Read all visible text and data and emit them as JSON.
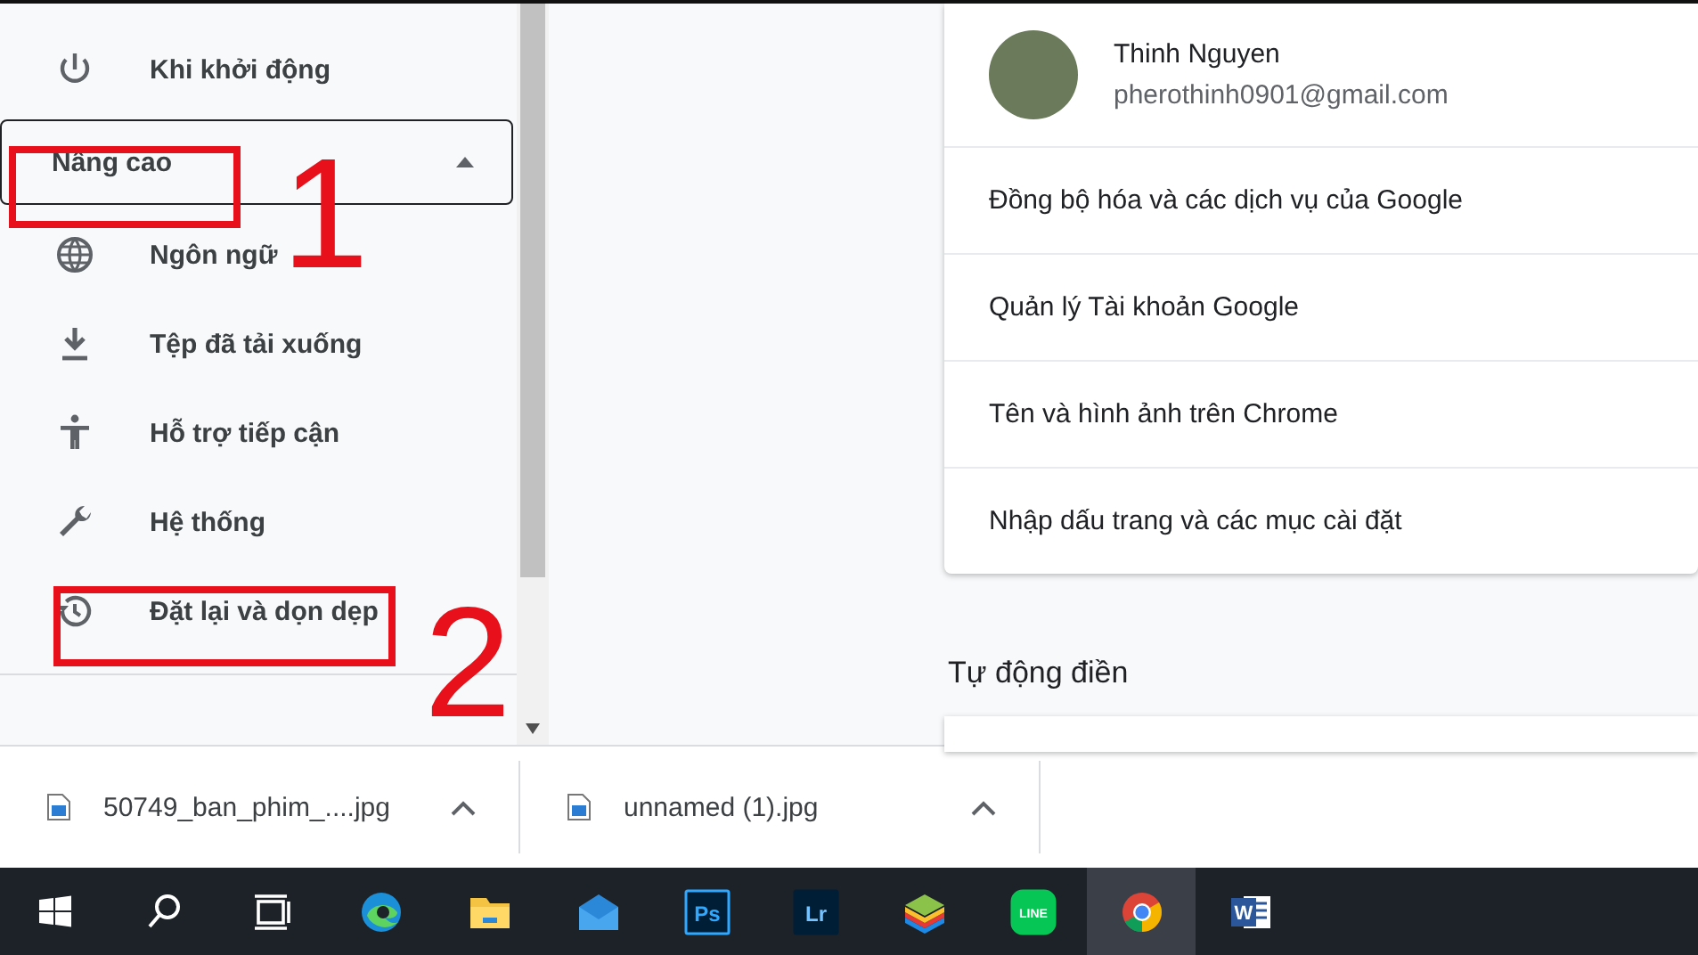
{
  "sidebar": {
    "items": [
      {
        "label": "Khi khởi động",
        "kind": "power"
      }
    ],
    "advanced": {
      "label": "Nâng cao",
      "expanded": true,
      "items": [
        {
          "label": "Ngôn ngữ",
          "kind": "globe"
        },
        {
          "label": "Tệp đã tải xuống",
          "kind": "download"
        },
        {
          "label": "Hỗ trợ tiếp cận",
          "kind": "person"
        },
        {
          "label": "Hệ thống",
          "kind": "wrench"
        },
        {
          "label": "Đặt lại và dọn dẹp",
          "kind": "history"
        }
      ]
    }
  },
  "annotations": [
    {
      "label": "1"
    },
    {
      "label": "2"
    }
  ],
  "account_card": {
    "name": "Thinh Nguyen",
    "email": "pherothinh0901@gmail.com",
    "rows": [
      "Đồng bộ hóa và các dịch vụ của Google",
      "Quản lý Tài khoản Google",
      "Tên và hình ảnh trên Chrome",
      "Nhập dấu trang và các mục cài đặt"
    ]
  },
  "autofill": {
    "title": "Tự động điền"
  },
  "downloads": [
    {
      "name": "50749_ban_phim_....jpg"
    },
    {
      "name": "unnamed (1).jpg"
    }
  ],
  "taskbar": [
    {
      "kind": "start",
      "selected": false
    },
    {
      "kind": "search",
      "selected": false
    },
    {
      "kind": "taskview",
      "selected": false
    },
    {
      "kind": "edge",
      "selected": false
    },
    {
      "kind": "folder",
      "selected": false
    },
    {
      "kind": "mail",
      "selected": false
    },
    {
      "kind": "ps",
      "label": "Ps",
      "selected": false
    },
    {
      "kind": "lr",
      "label": "Lr",
      "selected": false
    },
    {
      "kind": "stack",
      "selected": false
    },
    {
      "kind": "line",
      "label": "LINE",
      "selected": false
    },
    {
      "kind": "chrome",
      "selected": true
    },
    {
      "kind": "word",
      "label": "W",
      "selected": false
    }
  ]
}
